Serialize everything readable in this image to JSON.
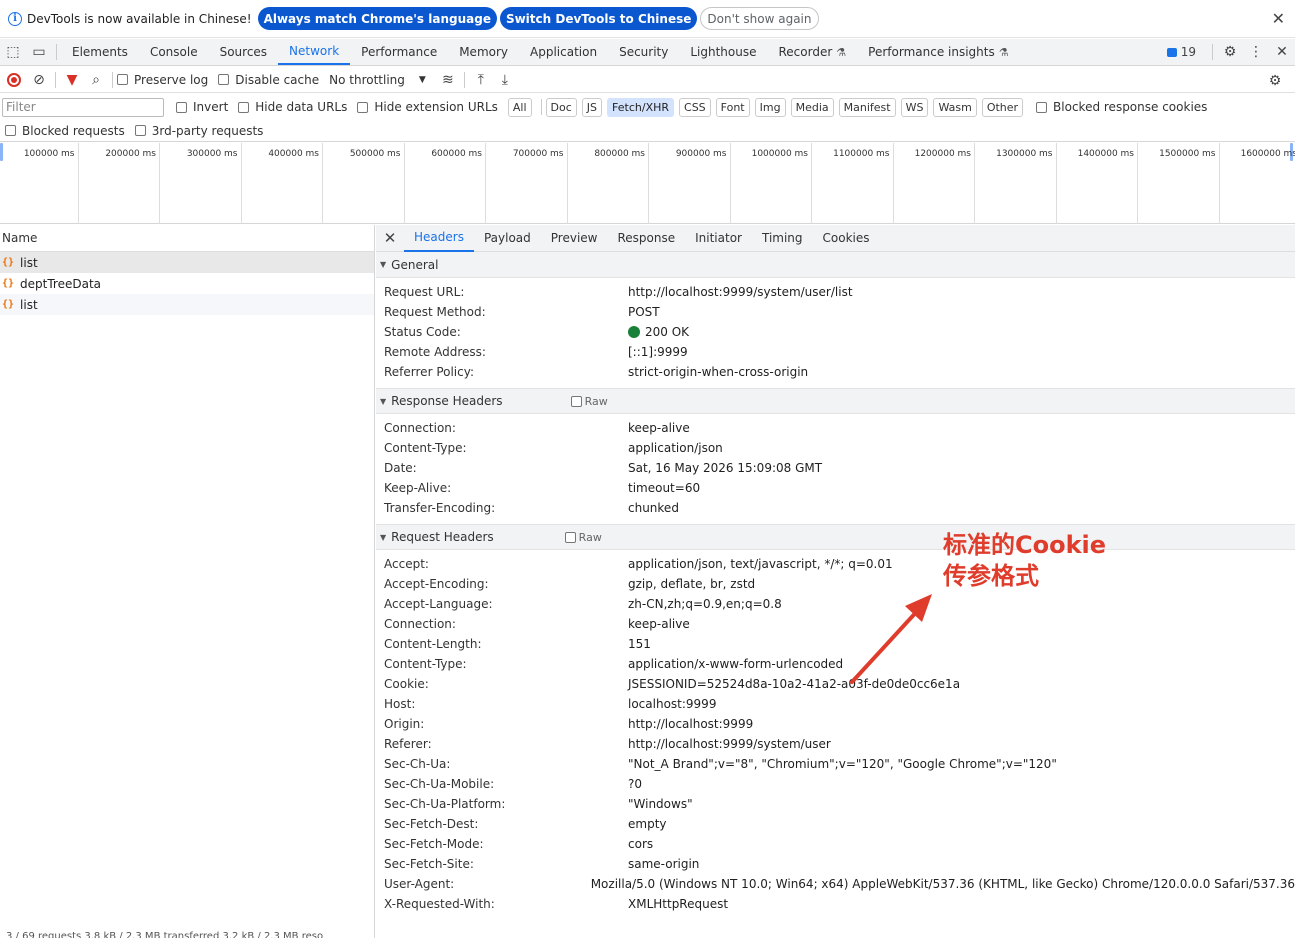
{
  "infobar": {
    "message": "DevTools is now available in Chinese!",
    "btn_match": "Always match Chrome's language",
    "btn_switch": "Switch DevTools to Chinese",
    "btn_dismiss": "Don't show again"
  },
  "tabs": [
    "Elements",
    "Console",
    "Sources",
    "Network",
    "Performance",
    "Memory",
    "Application",
    "Security",
    "Lighthouse",
    "Recorder",
    "Performance insights"
  ],
  "issues_count": "19",
  "toolbar": {
    "preserve_log": "Preserve log",
    "disable_cache": "Disable cache",
    "throttling": "No throttling"
  },
  "filter": {
    "placeholder": "Filter",
    "invert": "Invert",
    "hide_data_urls": "Hide data URLs",
    "hide_extension_urls": "Hide extension URLs",
    "types": [
      "All",
      "Doc",
      "JS",
      "Fetch/XHR",
      "CSS",
      "Font",
      "Img",
      "Media",
      "Manifest",
      "WS",
      "Wasm",
      "Other"
    ],
    "active_type": "Fetch/XHR",
    "blocked_cookies": "Blocked response cookies",
    "blocked_requests": "Blocked requests",
    "third_party": "3rd-party requests"
  },
  "timeline_ticks": [
    "100000 ms",
    "200000 ms",
    "300000 ms",
    "400000 ms",
    "500000 ms",
    "600000 ms",
    "700000 ms",
    "800000 ms",
    "900000 ms",
    "1000000 ms",
    "1100000 ms",
    "1200000 ms",
    "1300000 ms",
    "1400000 ms",
    "1500000 ms",
    "1600000 ms"
  ],
  "request_list": {
    "header": "Name",
    "rows": [
      "list",
      "deptTreeData",
      "list"
    ],
    "summary": "3 / 69 requests   3.8 kB / 2.3 MB transferred   3.2 kB / 2.3 MB reso"
  },
  "detail_tabs": [
    "Headers",
    "Payload",
    "Preview",
    "Response",
    "Initiator",
    "Timing",
    "Cookies"
  ],
  "general": {
    "title": "General",
    "rows": [
      {
        "k": "Request URL:",
        "v": "http://localhost:9999/system/user/list"
      },
      {
        "k": "Request Method:",
        "v": "POST"
      },
      {
        "k": "Status Code:",
        "v": "200 OK"
      },
      {
        "k": "Remote Address:",
        "v": "[::1]:9999"
      },
      {
        "k": "Referrer Policy:",
        "v": "strict-origin-when-cross-origin"
      }
    ]
  },
  "response_headers": {
    "title": "Response Headers",
    "raw": "Raw",
    "rows": [
      {
        "k": "Connection:",
        "v": "keep-alive"
      },
      {
        "k": "Content-Type:",
        "v": "application/json"
      },
      {
        "k": "Date:",
        "v": "Sat, 16 May 2026 15:09:08 GMT"
      },
      {
        "k": "Keep-Alive:",
        "v": "timeout=60"
      },
      {
        "k": "Transfer-Encoding:",
        "v": "chunked"
      }
    ]
  },
  "request_headers": {
    "title": "Request Headers",
    "raw": "Raw",
    "rows": [
      {
        "k": "Accept:",
        "v": "application/json, text/javascript, */*; q=0.01"
      },
      {
        "k": "Accept-Encoding:",
        "v": "gzip, deflate, br, zstd"
      },
      {
        "k": "Accept-Language:",
        "v": "zh-CN,zh;q=0.9,en;q=0.8"
      },
      {
        "k": "Connection:",
        "v": "keep-alive"
      },
      {
        "k": "Content-Length:",
        "v": "151"
      },
      {
        "k": "Content-Type:",
        "v": "application/x-www-form-urlencoded"
      },
      {
        "k": "Cookie:",
        "v": "JSESSIONID=52524d8a-10a2-41a2-a03f-de0de0cc6e1a"
      },
      {
        "k": "Host:",
        "v": "localhost:9999"
      },
      {
        "k": "Origin:",
        "v": "http://localhost:9999"
      },
      {
        "k": "Referer:",
        "v": "http://localhost:9999/system/user"
      },
      {
        "k": "Sec-Ch-Ua:",
        "v": "\"Not_A Brand\";v=\"8\", \"Chromium\";v=\"120\", \"Google Chrome\";v=\"120\""
      },
      {
        "k": "Sec-Ch-Ua-Mobile:",
        "v": "?0"
      },
      {
        "k": "Sec-Ch-Ua-Platform:",
        "v": "\"Windows\""
      },
      {
        "k": "Sec-Fetch-Dest:",
        "v": "empty"
      },
      {
        "k": "Sec-Fetch-Mode:",
        "v": "cors"
      },
      {
        "k": "Sec-Fetch-Site:",
        "v": "same-origin"
      },
      {
        "k": "User-Agent:",
        "v": "Mozilla/5.0 (Windows NT 10.0; Win64; x64) AppleWebKit/537.36 (KHTML, like Gecko) Chrome/120.0.0.0 Safari/537.36"
      },
      {
        "k": "X-Requested-With:",
        "v": "XMLHttpRequest"
      }
    ]
  },
  "annotation": {
    "line1": "标准的Cookie",
    "line2": "传参格式",
    "color": "#e03c2c"
  }
}
